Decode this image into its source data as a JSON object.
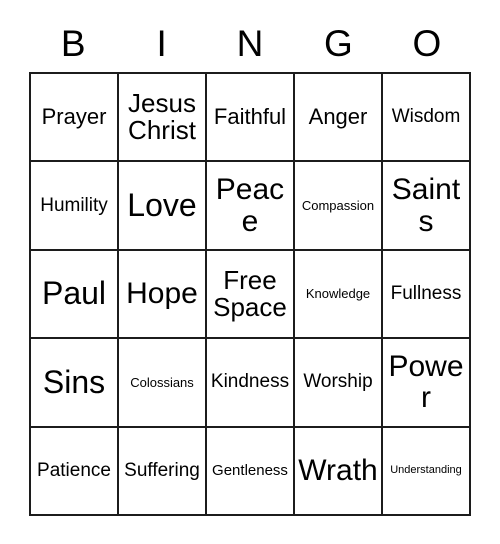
{
  "card": {
    "title": "BINGO",
    "header": [
      {
        "letter": "B"
      },
      {
        "letter": "I"
      },
      {
        "letter": "N"
      },
      {
        "letter": "G"
      },
      {
        "letter": "O"
      }
    ],
    "rows": [
      [
        {
          "label": "Prayer",
          "size": "s-md"
        },
        {
          "label": "Jesus Christ",
          "size": "s-lg"
        },
        {
          "label": "Faithful",
          "size": "s-md"
        },
        {
          "label": "Anger",
          "size": "s-md"
        },
        {
          "label": "Wisdom",
          "size": "s-sm"
        }
      ],
      [
        {
          "label": "Humility",
          "size": "s-sm"
        },
        {
          "label": "Love",
          "size": "s-xxl"
        },
        {
          "label": "Peace",
          "size": "s-xl"
        },
        {
          "label": "Compassion",
          "size": "s-xxs"
        },
        {
          "label": "Saints",
          "size": "s-xl"
        }
      ],
      [
        {
          "label": "Paul",
          "size": "s-xxl"
        },
        {
          "label": "Hope",
          "size": "s-xl"
        },
        {
          "label": "Free Space",
          "size": "s-lg"
        },
        {
          "label": "Knowledge",
          "size": "s-xxs"
        },
        {
          "label": "Fullness",
          "size": "s-sm"
        }
      ],
      [
        {
          "label": "Sins",
          "size": "s-xxl"
        },
        {
          "label": "Colossians",
          "size": "s-xxs"
        },
        {
          "label": "Kindness",
          "size": "s-sm"
        },
        {
          "label": "Worship",
          "size": "s-sm"
        },
        {
          "label": "Power",
          "size": "s-xl"
        }
      ],
      [
        {
          "label": "Patience",
          "size": "s-sm"
        },
        {
          "label": "Suffering",
          "size": "s-sm"
        },
        {
          "label": "Gentleness",
          "size": "s-xs"
        },
        {
          "label": "Wrath",
          "size": "s-xl"
        },
        {
          "label": "Understanding",
          "size": "s-tiny"
        }
      ]
    ]
  },
  "colors": {
    "background": "#ffffff",
    "border": "#1c1c1c",
    "text": "#000000"
  }
}
